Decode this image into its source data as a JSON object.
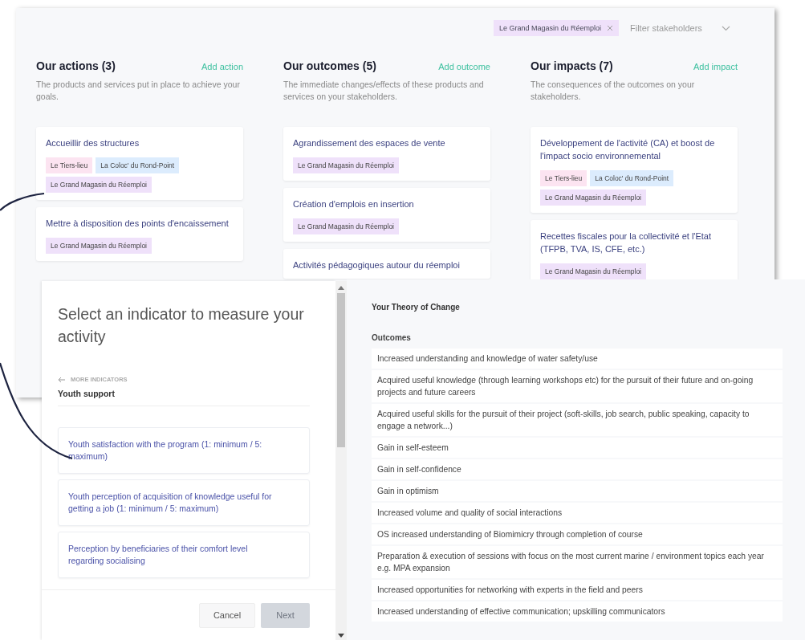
{
  "board": {
    "filter": {
      "chip": "Le Grand Magasin du Réemploi",
      "placeholder": "Filter stakeholders"
    },
    "columns": [
      {
        "title": "Our actions (3)",
        "action": "Add action",
        "description": "The products and services put in place to achieve your goals.",
        "cards": [
          {
            "title": "Accueillir des structures",
            "tags": [
              {
                "label": "Le Tiers-lieu",
                "color": "#fce4f1"
              },
              {
                "label": "La Coloc' du Rond-Point",
                "color": "#dcecfd"
              },
              {
                "label": "Le Grand Magasin du Réemploi",
                "color": "#efe1fa"
              }
            ]
          },
          {
            "title": "Mettre à disposition des points d'encaissement",
            "tags": [
              {
                "label": "Le Grand Magasin du Réemploi",
                "color": "#efe1fa"
              }
            ]
          }
        ]
      },
      {
        "title": "Our outcomes (5)",
        "action": "Add outcome",
        "description": "The immediate changes/effects of these products and services on your stakeholders.",
        "cards": [
          {
            "title": "Agrandissement des espaces de vente",
            "tags": [
              {
                "label": "Le Grand Magasin du Réemploi",
                "color": "#efe1fa"
              }
            ]
          },
          {
            "title": "Création d'emplois en insertion",
            "tags": [
              {
                "label": "Le Grand Magasin du Réemploi",
                "color": "#efe1fa"
              }
            ]
          },
          {
            "title": "Activités pédagogiques autour du réemploi"
          }
        ]
      },
      {
        "title": "Our impacts (7)",
        "action": "Add impact",
        "description": "The consequences of the outcomes on your stakeholders.",
        "cards": [
          {
            "title": "Développement de l'activité (CA) et boost de l'impact socio environnemental",
            "tags": [
              {
                "label": "Le Tiers-lieu",
                "color": "#fce4f1"
              },
              {
                "label": "La Coloc' du Rond-Point",
                "color": "#dcecfd"
              },
              {
                "label": "Le Grand Magasin du Réemploi",
                "color": "#efe1fa"
              }
            ]
          },
          {
            "title": "Recettes fiscales pour la collectivité et l'Etat (TFPB, TVA, IS, CFE, etc.)",
            "tags": [
              {
                "label": "Le Grand Magasin du Réemploi",
                "color": "#efe1fa"
              }
            ]
          }
        ]
      }
    ]
  },
  "modal": {
    "title": "Select an indicator to measure your activity",
    "back_link": "MORE INDICATORS",
    "category": "Youth support",
    "indicators": [
      "Youth satisfaction with the program (1: minimum / 5: maximum)",
      "Youth perception of acquisition of knowledge useful for getting a job (1: minimum / 5: maximum)",
      "Perception by beneficiaries of their comfort level regarding socialising"
    ],
    "buttons": [
      {
        "label": "Cancel",
        "disabled": false
      },
      {
        "label": "Next",
        "disabled": true
      }
    ]
  },
  "panel": {
    "title": "Your Theory of Change",
    "section": "Outcomes",
    "outcomes": [
      "Increased understanding and knowledge of water safety/use",
      "Acquired useful knowledge (through learning workshops etc) for the pursuit of their future and on-going projects and future careers",
      "Acquired useful skills for the pursuit of their project (soft-skills, job search, public speaking, capacity to engage a network...)",
      "Gain in self-esteem",
      "Gain in self-confidence",
      "Gain in optimism",
      "Increased volume and quality of social interactions",
      "OS increased understanding of Biomimicry through completion of course",
      "Preparation & execution of sessions with focus on the most current marine / environment topics each year e.g. MPA expansion",
      "Increased opportunities for networking with experts in the field and peers",
      "Increased understanding of effective communication; upskilling communicators"
    ]
  }
}
